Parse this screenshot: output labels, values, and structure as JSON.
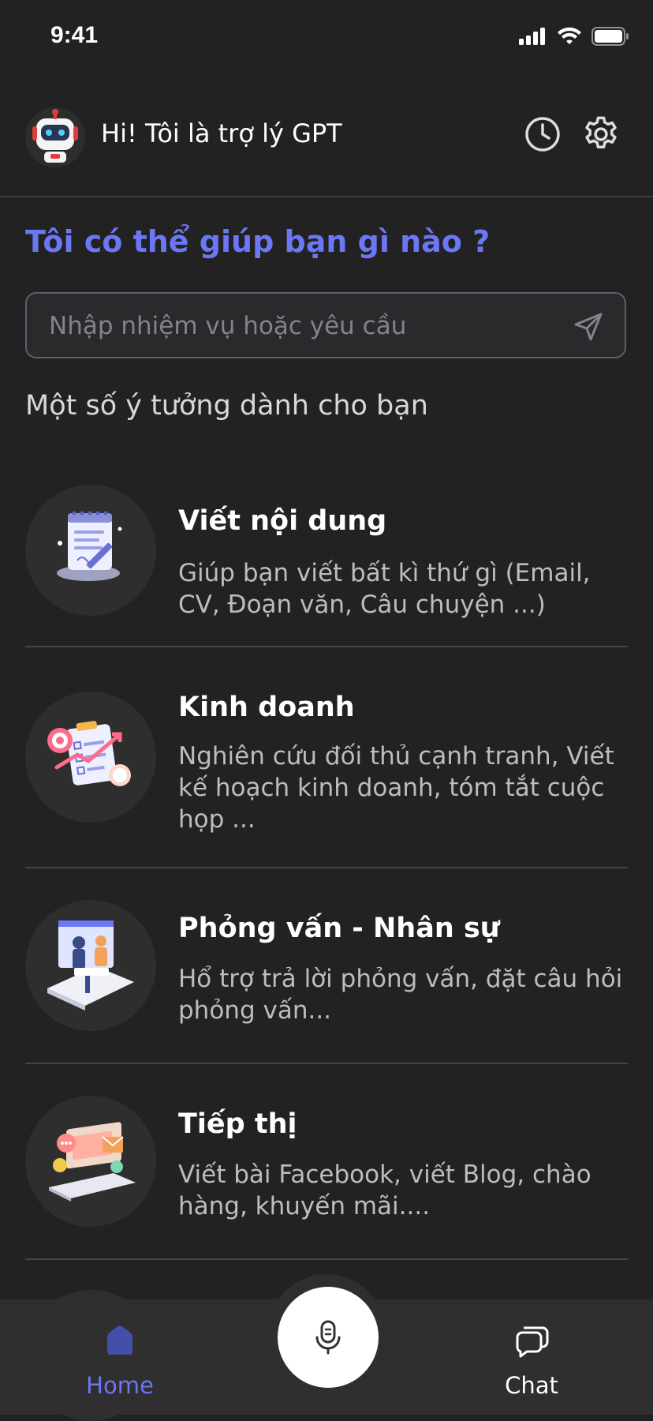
{
  "status": {
    "time": "9:41"
  },
  "header": {
    "title": "Hi! Tôi là trợ lý GPT"
  },
  "main": {
    "heading": "Tôi có thể giúp bạn gì nào ?",
    "search_placeholder": "Nhập nhiệm vụ hoặc yêu cầu",
    "ideas_heading": "Một số ý tưởng dành cho bạn",
    "ideas": [
      {
        "title": "Viết nội dung",
        "desc": "Giúp bạn viết bất kì thứ gì (Email, CV, Đoạn văn, Câu chuyện ...)",
        "icon": "notepad-pen-icon"
      },
      {
        "title": "Kinh doanh",
        "desc": "Nghiên cứu đối thủ cạnh tranh, Viết kế hoạch kinh doanh, tóm tắt cuộc họp ...",
        "icon": "clipboard-chart-icon"
      },
      {
        "title": "Phỏng vấn - Nhân sự",
        "desc": "Hổ trợ trả lời phỏng vấn, đặt câu hỏi phỏng vấn...",
        "icon": "interview-icon"
      },
      {
        "title": "Tiếp thị",
        "desc": "Viết bài Facebook, viết Blog, chào hàng, khuyến mãi....",
        "icon": "laptop-marketing-icon"
      }
    ]
  },
  "nav": {
    "home_label": "Home",
    "chat_label": "Chat"
  },
  "colors": {
    "accent": "#6b77f5",
    "background": "#222222"
  }
}
